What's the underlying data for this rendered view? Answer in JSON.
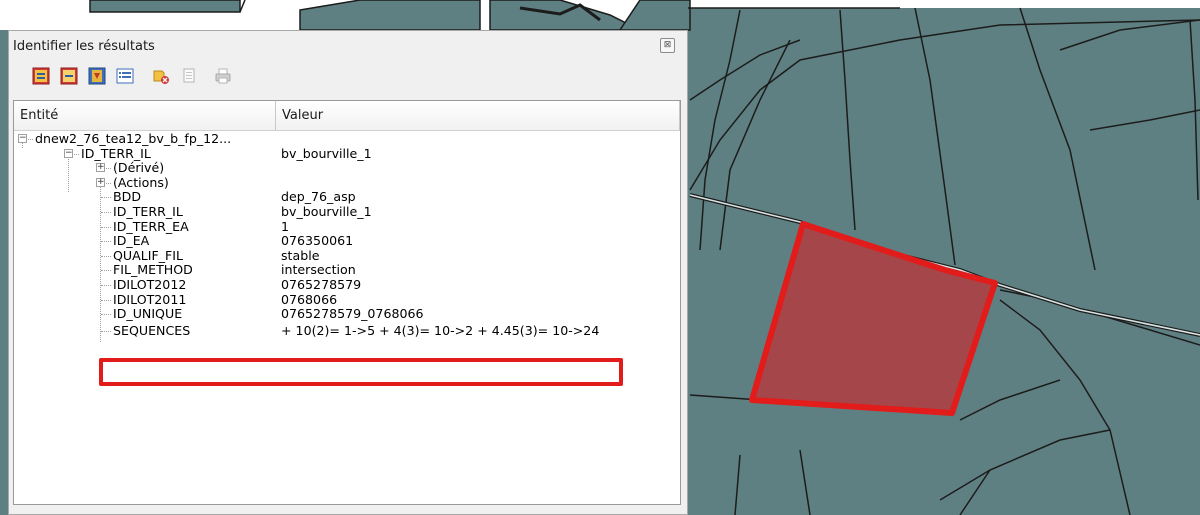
{
  "window": {
    "title": "Identifier les résultats",
    "close_glyph": "⊠"
  },
  "toolbar": {
    "buttons": [
      {
        "name": "expand-all-icon"
      },
      {
        "name": "collapse-all-icon"
      },
      {
        "name": "expand-new-icon"
      },
      {
        "name": "form-view-icon"
      },
      {
        "name": "clear-results-icon"
      },
      {
        "name": "copy-icon"
      },
      {
        "name": "print-icon"
      }
    ]
  },
  "table": {
    "header_entity": "Entité",
    "header_value": "Valeur",
    "layer": "dnew2_76_tea12_bv_b_fp_12...",
    "feature": {
      "name": "ID_TERR_IL",
      "value": "bv_bourville_1"
    },
    "groups": [
      "(Dérivé)",
      "(Actions)"
    ],
    "attributes": [
      {
        "name": "BDD",
        "value": "dep_76_asp"
      },
      {
        "name": "ID_TERR_IL",
        "value": "bv_bourville_1"
      },
      {
        "name": "ID_TERR_EA",
        "value": "1"
      },
      {
        "name": "ID_EA",
        "value": "076350061"
      },
      {
        "name": "QUALIF_FIL",
        "value": "stable"
      },
      {
        "name": "FIL_METHOD",
        "value": "intersection"
      },
      {
        "name": "IDILOT2012",
        "value": "0765278579"
      },
      {
        "name": "IDILOT2011",
        "value": "0768066"
      },
      {
        "name": "ID_UNIQUE",
        "value": "0765278579_0768066"
      },
      {
        "name": "SEQUENCES",
        "value": "+ 10(2)= 1->5 + 4(3)= 10->2 + 4.45(3)= 10->24"
      }
    ]
  },
  "colors": {
    "map_fill": "#5f8082",
    "parcel_line": "#1c1c1c",
    "highlight_red": "#e21b1b",
    "selected_parcel_fill": "#a5474a"
  }
}
